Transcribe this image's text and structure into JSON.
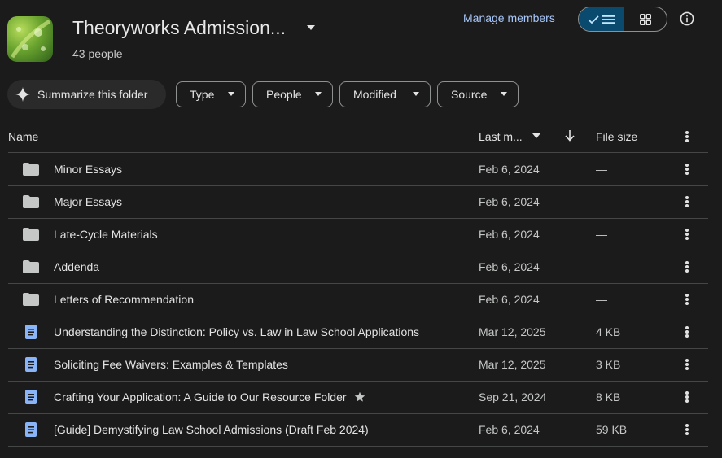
{
  "header": {
    "title": "Theoryworks Admission...",
    "members": "43 people",
    "manage_members": "Manage members"
  },
  "chips": {
    "summarize": "Summarize this folder",
    "type": "Type",
    "people": "People",
    "modified": "Modified",
    "source": "Source"
  },
  "table": {
    "col_name": "Name",
    "col_modified": "Last m...",
    "col_size": "File size"
  },
  "rows": [
    {
      "kind": "folder",
      "name": "Minor Essays",
      "modified": "Feb 6, 2024",
      "size": "—"
    },
    {
      "kind": "folder",
      "name": "Major Essays",
      "modified": "Feb 6, 2024",
      "size": "—"
    },
    {
      "kind": "folder",
      "name": "Late-Cycle Materials",
      "modified": "Feb 6, 2024",
      "size": "—"
    },
    {
      "kind": "folder",
      "name": "Addenda",
      "modified": "Feb 6, 2024",
      "size": "—"
    },
    {
      "kind": "folder",
      "name": "Letters of Recommendation",
      "modified": "Feb 6, 2024",
      "size": "—"
    },
    {
      "kind": "doc",
      "name": "Understanding the Distinction: Policy vs. Law in Law School Applications",
      "modified": "Mar 12, 2025",
      "size": "4 KB"
    },
    {
      "kind": "doc",
      "name": "Soliciting Fee Waivers: Examples & Templates",
      "modified": "Mar 12, 2025",
      "size": "3 KB"
    },
    {
      "kind": "doc",
      "name": "Crafting Your Application: A Guide to Our Resource Folder",
      "modified": "Sep 21, 2024",
      "size": "8 KB",
      "starred": true
    },
    {
      "kind": "doc",
      "name": "[Guide] Demystifying Law School Admissions (Draft Feb 2024)",
      "modified": "Feb 6, 2024",
      "size": "59 KB"
    }
  ],
  "colors": {
    "background": "#1b1b1b",
    "accent": "#a8c7fa",
    "doc_icon": "#8ab4f8",
    "folder_icon": "#c4c7c5",
    "toggle_active": "#0b4a6f"
  }
}
